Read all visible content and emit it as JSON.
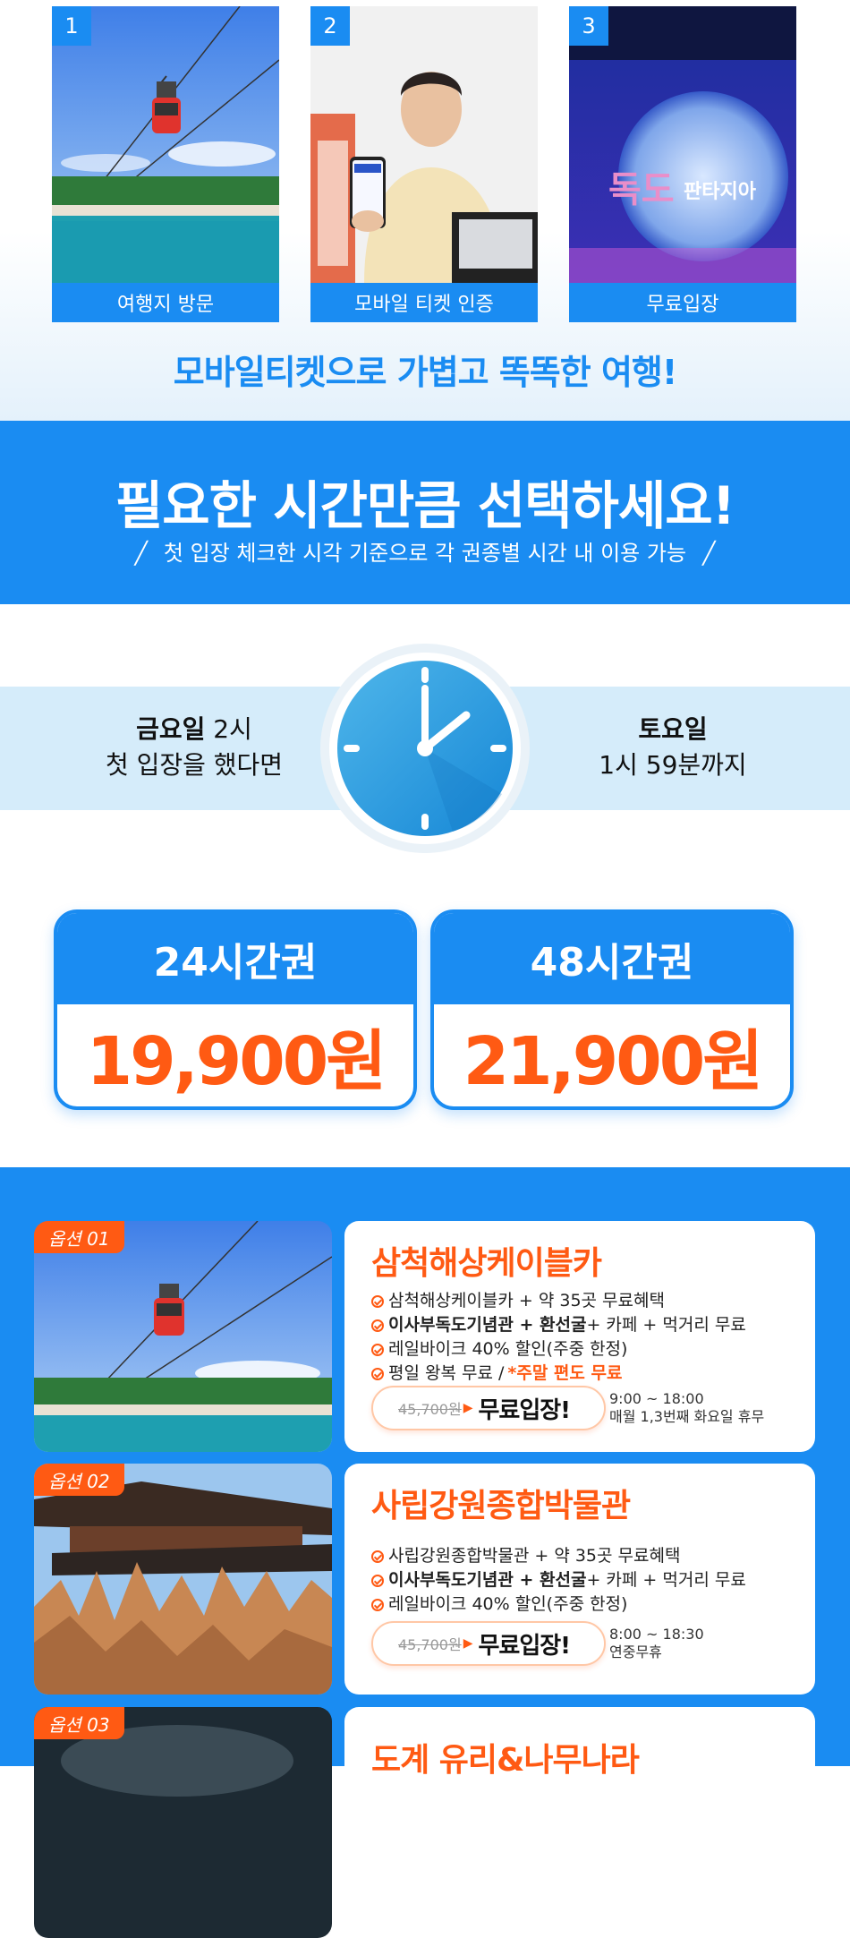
{
  "steps": [
    {
      "number": "1",
      "caption": "여행지 방문"
    },
    {
      "number": "2",
      "caption": "모바일 티켓 인증"
    },
    {
      "number": "3",
      "caption": "무료입장"
    }
  ],
  "step3_sign": {
    "big": "독도",
    "small": "판타지아"
  },
  "steps_tagline": "모바일티켓으로 가볍고 똑똑한 여행!",
  "time_section": {
    "headline": "필요한 시간만큼 선택하세요!",
    "subline": "첫 입장 체크한 시각 기준으로 각 권종별 시간 내 이용 가능"
  },
  "example": {
    "left_bold": "금요일",
    "left_time": " 2시",
    "left_line2": "첫 입장을 했다면",
    "right_bold": "토요일",
    "right_line2": "1시 59분까지"
  },
  "tickets": [
    {
      "name": "24시간권",
      "price": "19,900원"
    },
    {
      "name": "48시간권",
      "price": "21,900원"
    }
  ],
  "options": [
    {
      "tag": "옵션 01",
      "title": "삼척해상케이블카",
      "lines": [
        {
          "plain": "삼척해상케이블카 + 약 35곳 무료혜택"
        },
        {
          "bold": "이사부독도기념관 + 환선굴",
          "plain": " + 카페 + 먹거리 무료"
        },
        {
          "plain": "레일바이크 40% 할인(주중 한정)"
        },
        {
          "plain": "평일 왕복 무료 /",
          "highlight": "*주말 편도 무료"
        }
      ],
      "old_price": "45,700원",
      "free_label": "무료입장!",
      "hours": "9:00 ~ 18:00",
      "closed": "매월 1,3번째 화요일 휴무"
    },
    {
      "tag": "옵션 02",
      "title": "사립강원종합박물관",
      "lines": [
        {
          "plain": "사립강원종합박물관 + 약 35곳 무료혜택"
        },
        {
          "bold": "이사부독도기념관 + 환선굴",
          "plain": " + 카페 + 먹거리 무료"
        },
        {
          "plain": "레일바이크 40% 할인(주중 한정)"
        }
      ],
      "old_price": "45,700원",
      "free_label": "무료입장!",
      "hours": "8:00 ~ 18:30",
      "closed": "연중무휴"
    },
    {
      "tag": "옵션 03",
      "title": "도계 유리&나무나라"
    }
  ],
  "colors": {
    "brand_blue": "#1a8cf2",
    "accent_orange": "#ff5a13"
  }
}
